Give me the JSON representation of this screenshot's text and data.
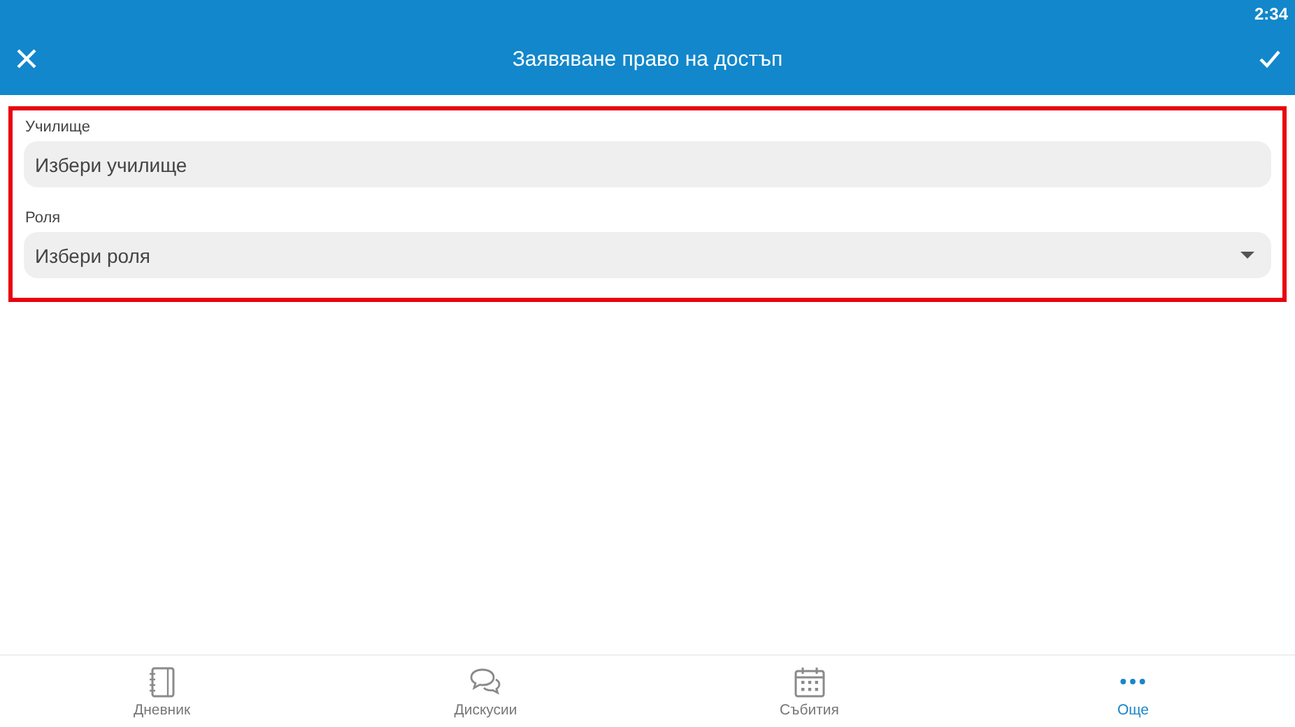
{
  "status_bar": {
    "time": "2:34"
  },
  "toolbar": {
    "title": "Заявяване право на достъп"
  },
  "form": {
    "fields": [
      {
        "label": "Училище",
        "placeholder": "Избери училище",
        "kind": "text"
      },
      {
        "label": "Роля",
        "placeholder": "Избери роля",
        "kind": "dropdown"
      }
    ]
  },
  "bottom_nav": [
    {
      "label": "Дневник",
      "kind": "notebook",
      "selected": false
    },
    {
      "label": "Дискусии",
      "kind": "chat",
      "selected": false
    },
    {
      "label": "Събития",
      "kind": "calendar",
      "selected": false
    },
    {
      "label": "Още",
      "kind": "more",
      "selected": true
    }
  ]
}
